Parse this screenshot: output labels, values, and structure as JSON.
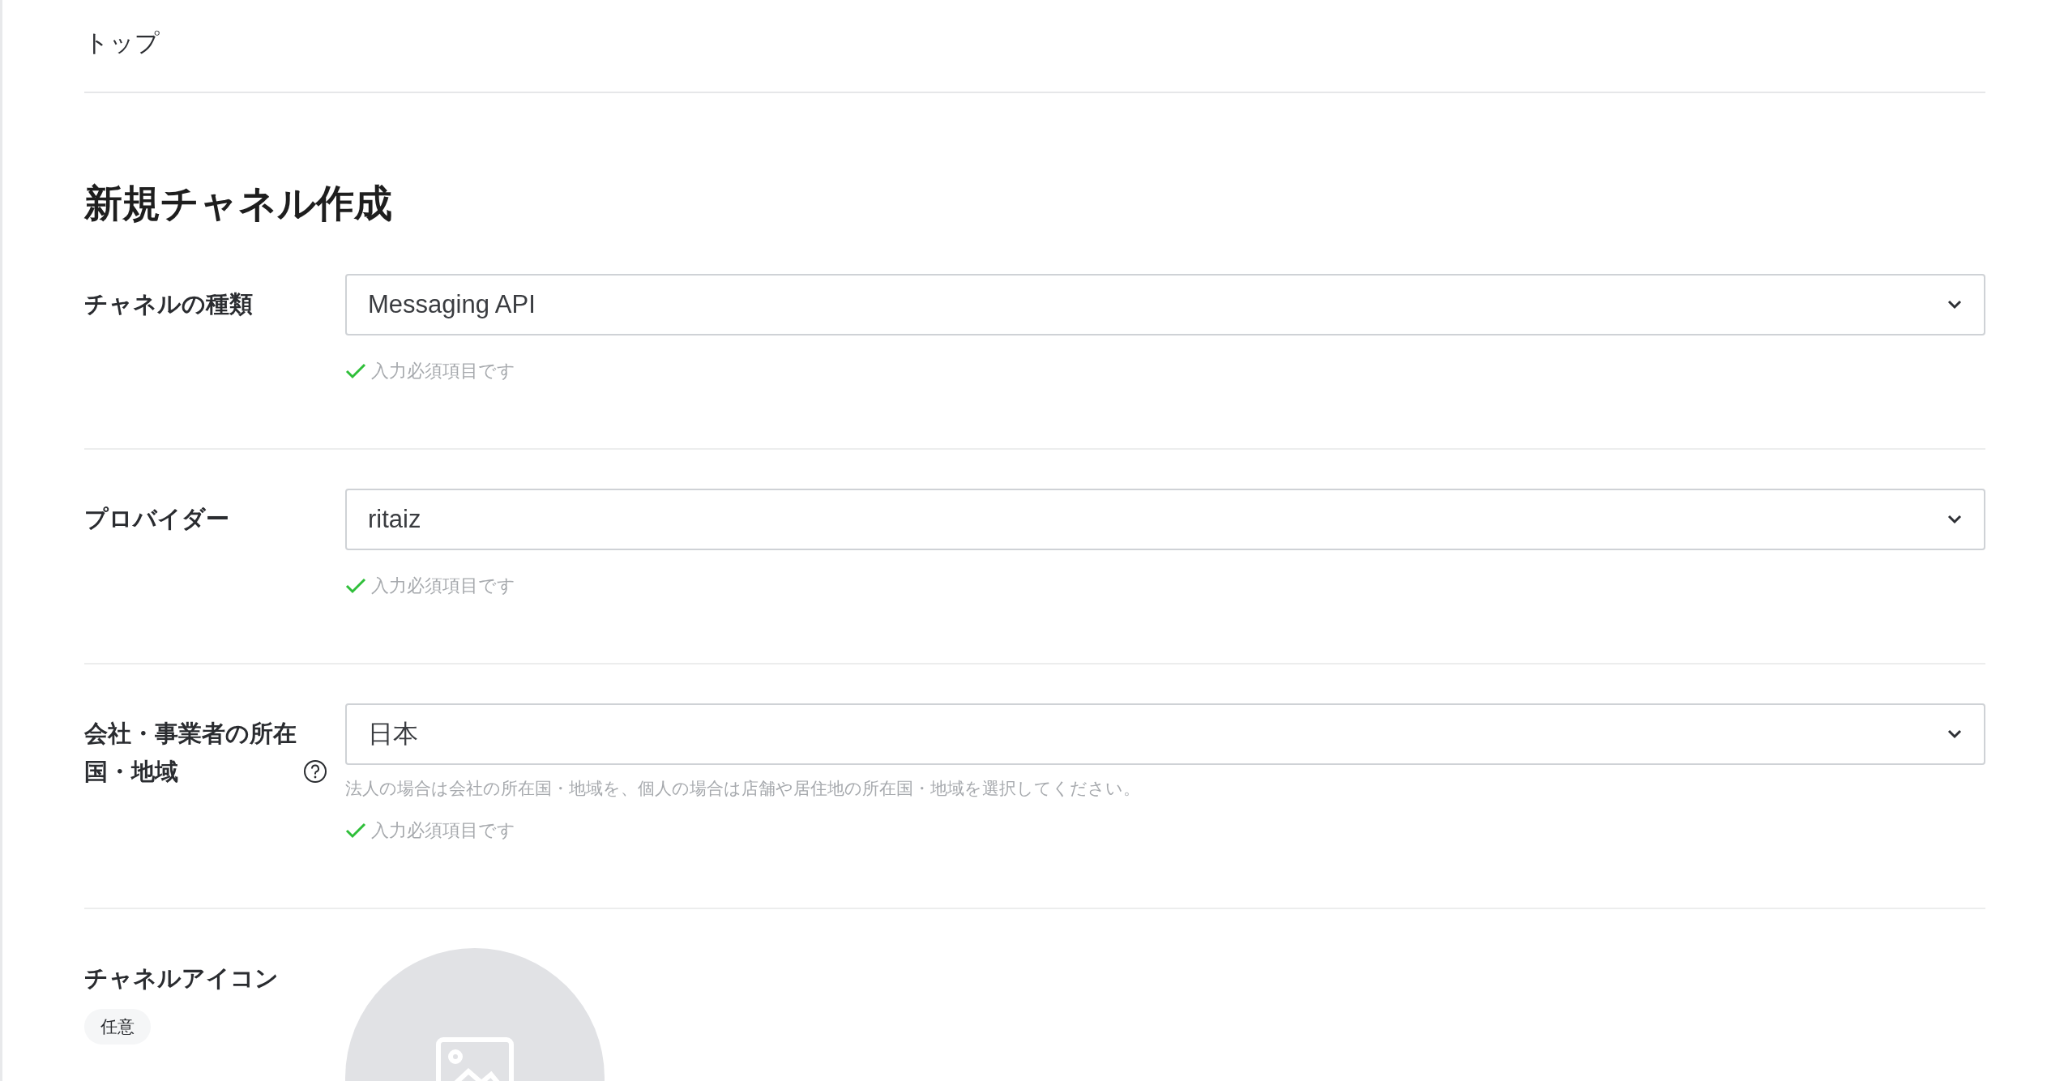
{
  "breadcrumb": "トップ",
  "title": "新規チャネル作成",
  "fields": [
    {
      "kind": "select",
      "label": "チャネルの種類",
      "help": false,
      "value": "Messaging API",
      "validation": {
        "valid": true,
        "text": "入力必須項目です"
      }
    },
    {
      "kind": "select",
      "label": "プロバイダー",
      "help": false,
      "value": "ritaiz",
      "validation": {
        "valid": true,
        "text": "入力必須項目です"
      }
    },
    {
      "kind": "select",
      "label": "会社・事業者の所在国・地域",
      "help": true,
      "value": "日本",
      "hint": "法人の場合は会社の所在国・地域を、個人の場合は店舗や居住地の所在国・地域を選択してください。",
      "validation": {
        "valid": true,
        "text": "入力必須項目です"
      }
    },
    {
      "kind": "icon-upload",
      "label": "チャネルアイコン",
      "help": false,
      "badge": "任意"
    }
  ]
}
